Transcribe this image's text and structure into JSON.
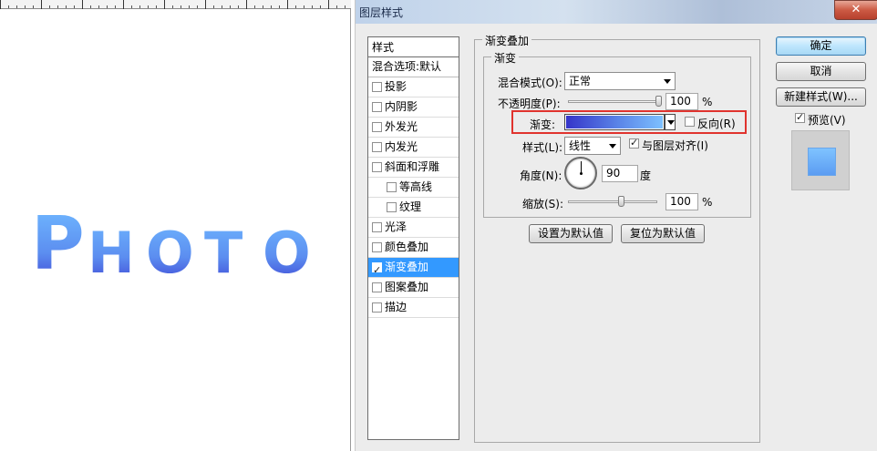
{
  "dialog": {
    "title": "图层样式"
  },
  "canvas": {
    "text_chars": [
      "P",
      "H",
      "O",
      "T",
      "O"
    ]
  },
  "styles_list": {
    "header": "样式",
    "blend_options": "混合选项:默认",
    "items": [
      {
        "label": "投影",
        "checked": false,
        "indent": false,
        "selected": false
      },
      {
        "label": "内阴影",
        "checked": false,
        "indent": false,
        "selected": false
      },
      {
        "label": "外发光",
        "checked": false,
        "indent": false,
        "selected": false
      },
      {
        "label": "内发光",
        "checked": false,
        "indent": false,
        "selected": false
      },
      {
        "label": "斜面和浮雕",
        "checked": false,
        "indent": false,
        "selected": false
      },
      {
        "label": "等高线",
        "checked": false,
        "indent": true,
        "selected": false
      },
      {
        "label": "纹理",
        "checked": false,
        "indent": true,
        "selected": false
      },
      {
        "label": "光泽",
        "checked": false,
        "indent": false,
        "selected": false
      },
      {
        "label": "颜色叠加",
        "checked": false,
        "indent": false,
        "selected": false
      },
      {
        "label": "渐变叠加",
        "checked": true,
        "indent": false,
        "selected": true
      },
      {
        "label": "图案叠加",
        "checked": false,
        "indent": false,
        "selected": false
      },
      {
        "label": "描边",
        "checked": false,
        "indent": false,
        "selected": false
      }
    ]
  },
  "gradient_overlay": {
    "group_title": "渐变叠加",
    "sub_group_title": "渐变",
    "blend_mode_label": "混合模式(O):",
    "blend_mode_value": "正常",
    "opacity_label": "不透明度(P):",
    "opacity_value": "100",
    "opacity_unit": "%",
    "opacity_fraction": 1.0,
    "gradient_label": "渐变:",
    "reverse_label": "反向(R)",
    "reverse_checked": false,
    "style_label": "样式(L):",
    "style_value": "线性",
    "align_label": "与图层对齐(I)",
    "align_checked": true,
    "angle_label": "角度(N):",
    "angle_value": "90",
    "angle_unit": "度",
    "scale_label": "缩放(S):",
    "scale_value": "100",
    "scale_unit": "%",
    "scale_fraction": 0.6,
    "set_default_label": "设置为默认值",
    "reset_default_label": "复位为默认值",
    "gradient_colors": [
      "#3535c9",
      "#5b86e8",
      "#7dc0ff"
    ]
  },
  "buttons": {
    "ok": "确定",
    "cancel": "取消",
    "new_style": "新建样式(W)...",
    "preview_label": "预览(V)",
    "preview_checked": true
  },
  "colors": {
    "selection": "#3399ff",
    "highlight_border": "#e0332e",
    "text_gradient_top": "#6fb7ff",
    "text_gradient_bottom": "#3a3ad0"
  }
}
